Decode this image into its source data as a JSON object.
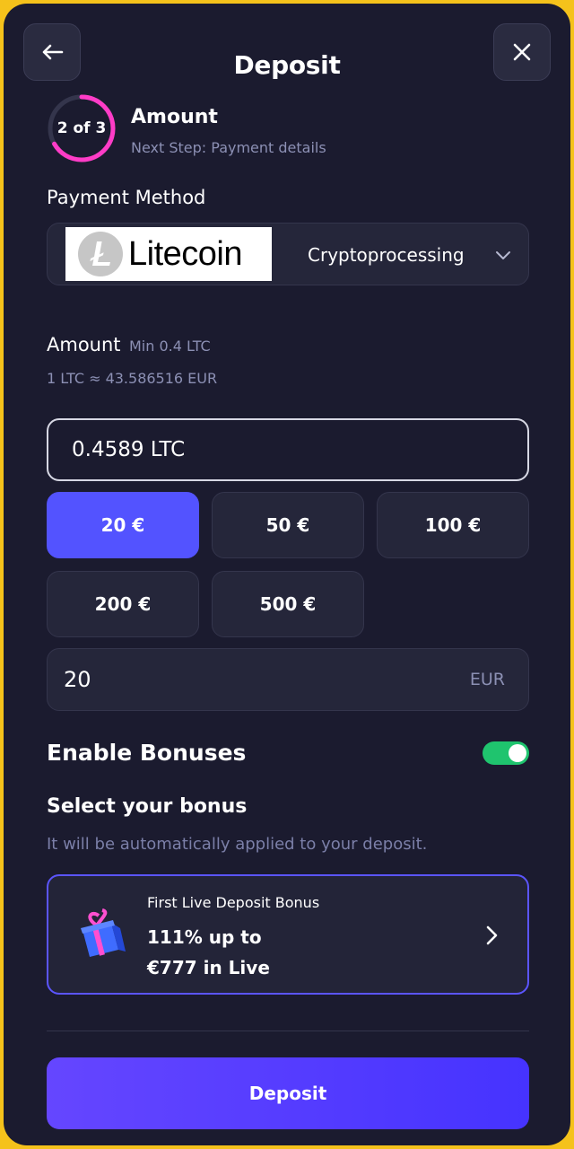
{
  "header": {
    "title": "Deposit",
    "back_icon": "arrow-left-icon",
    "close_icon": "close-icon"
  },
  "step": {
    "counter": "2 of 3",
    "progress": 0.6667,
    "title": "Amount",
    "next": "Next Step: Payment details"
  },
  "payment": {
    "label": "Payment Method",
    "logo_text": "Litecoin",
    "provider": "Cryptoprocessing"
  },
  "amount": {
    "label": "Amount",
    "min": "Min 0.4 LTC",
    "rate": "1 LTC ≈ 43.586516 EUR",
    "crypto_value": "0.4589 LTC",
    "presets": [
      {
        "label": "20 €",
        "active": true
      },
      {
        "label": "50 €",
        "active": false
      },
      {
        "label": "100 €",
        "active": false
      },
      {
        "label": "200 €",
        "active": false
      },
      {
        "label": "500 €",
        "active": false
      }
    ],
    "fiat_value": "20",
    "fiat_unit": "EUR"
  },
  "bonus": {
    "enable_label": "Enable Bonuses",
    "enabled": true,
    "select_label": "Select your bonus",
    "hint": "It will be automatically applied to your deposit.",
    "card": {
      "title": "First Live Deposit Bonus",
      "line1": "111% up to",
      "line2": "€777 in Live",
      "icon": "gift-icon"
    }
  },
  "footer": {
    "deposit_label": "Deposit"
  },
  "colors": {
    "background": "#1b1b2f",
    "accent": "#5353ff",
    "toggle_on": "#1fc46e",
    "progress_ring": "#ff3cc7",
    "frame": "#f5c21b"
  }
}
